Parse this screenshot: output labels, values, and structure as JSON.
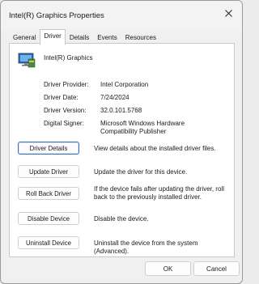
{
  "window": {
    "title": "Intel(R) Graphics Properties"
  },
  "tabs": [
    {
      "label": "General",
      "active": false
    },
    {
      "label": "Driver",
      "active": true
    },
    {
      "label": "Details",
      "active": false
    },
    {
      "label": "Events",
      "active": false
    },
    {
      "label": "Resources",
      "active": false
    }
  ],
  "device": {
    "name": "Intel(R) Graphics",
    "icon": "display-adapter-icon"
  },
  "info": [
    {
      "label": "Driver Provider:",
      "value": "Intel Corporation"
    },
    {
      "label": "Driver Date:",
      "value": "7/24/2024"
    },
    {
      "label": "Driver Version:",
      "value": "32.0.101.5768"
    },
    {
      "label": "Digital Signer:",
      "value": "Microsoft Windows Hardware Compatibility Publisher"
    }
  ],
  "actions": [
    {
      "button": "Driver Details",
      "description": "View details about the installed driver files."
    },
    {
      "button": "Update Driver",
      "description": "Update the driver for this device."
    },
    {
      "button": "Roll Back Driver",
      "description": "If the device fails after updating the driver, roll back to the previously installed driver."
    },
    {
      "button": "Disable Device",
      "description": "Disable the device."
    },
    {
      "button": "Uninstall Device",
      "description": "Uninstall the device from the system (Advanced)."
    }
  ],
  "footer": {
    "ok_label": "OK",
    "cancel_label": "Cancel"
  },
  "colors": {
    "focus_border": "#3a6fc4",
    "window_bg": "#f0f0f0",
    "panel_bg": "#ffffff"
  }
}
